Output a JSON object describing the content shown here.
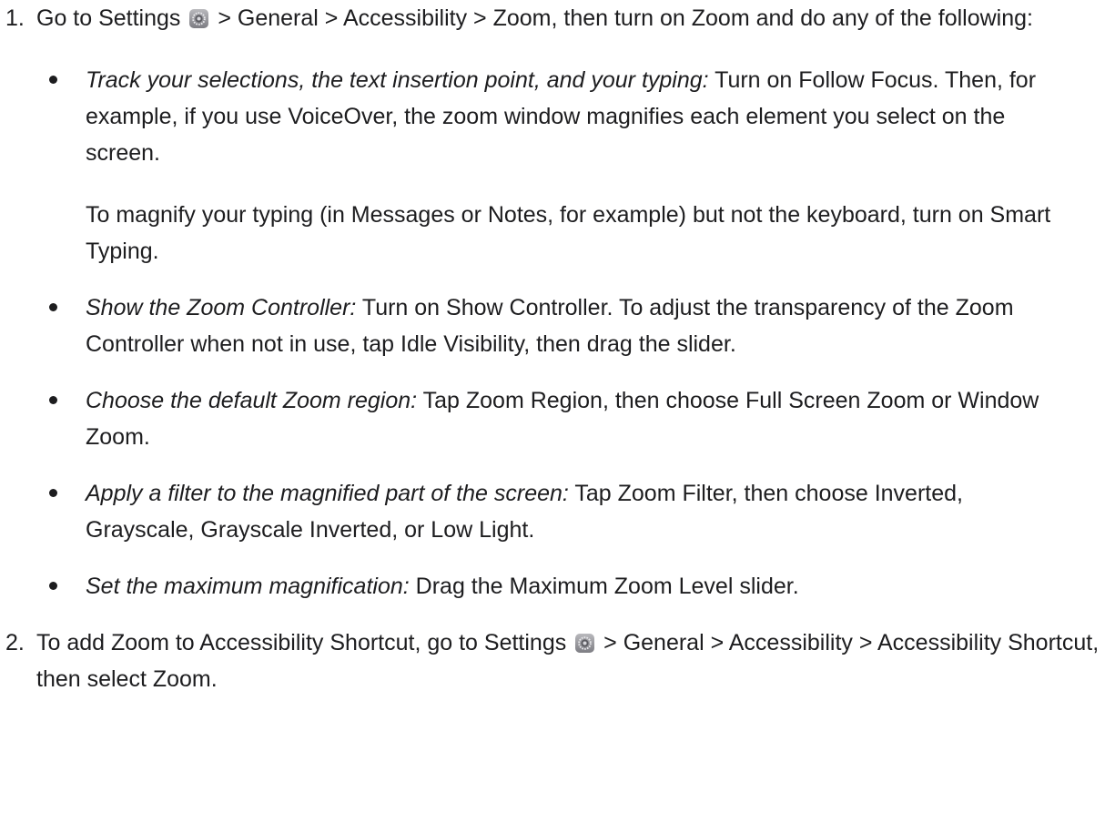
{
  "steps": [
    {
      "number": "1.",
      "intro": {
        "before_icon": "Go to Settings",
        "icon": "settings-gear-icon",
        "after_icon": "> General > Accessibility > Zoom, then turn on Zoom and do any of the following:"
      },
      "bullets": [
        {
          "lead": "Track your selections, the text insertion point, and your typing:",
          "text": "Turn on Follow Focus. Then, for example, if you use VoiceOver, the zoom window magnifies each element you select on the screen.",
          "extra": "To magnify your typing (in Messages or Notes, for example) but not the keyboard, turn on Smart Typing."
        },
        {
          "lead": "Show the Zoom Controller:",
          "text": "Turn on Show Controller. To adjust the transparency of the Zoom Controller when not in use, tap Idle Visibility, then drag the slider."
        },
        {
          "lead": "Choose the default Zoom region:",
          "text": "Tap Zoom Region, then choose Full Screen Zoom or Window Zoom."
        },
        {
          "lead": "Apply a filter to the magnified part of the screen:",
          "text": "Tap Zoom Filter, then choose Inverted, Grayscale, Grayscale Inverted, or Low Light."
        },
        {
          "lead": "Set the maximum magnification:",
          "text": "Drag the Maximum Zoom Level slider."
        }
      ]
    },
    {
      "number": "2.",
      "intro": {
        "before_icon": "To add Zoom to Accessibility Shortcut, go to Settings",
        "icon": "settings-gear-icon",
        "after_icon": "> General > Accessibility > Accessibility Shortcut, then select Zoom."
      }
    }
  ]
}
